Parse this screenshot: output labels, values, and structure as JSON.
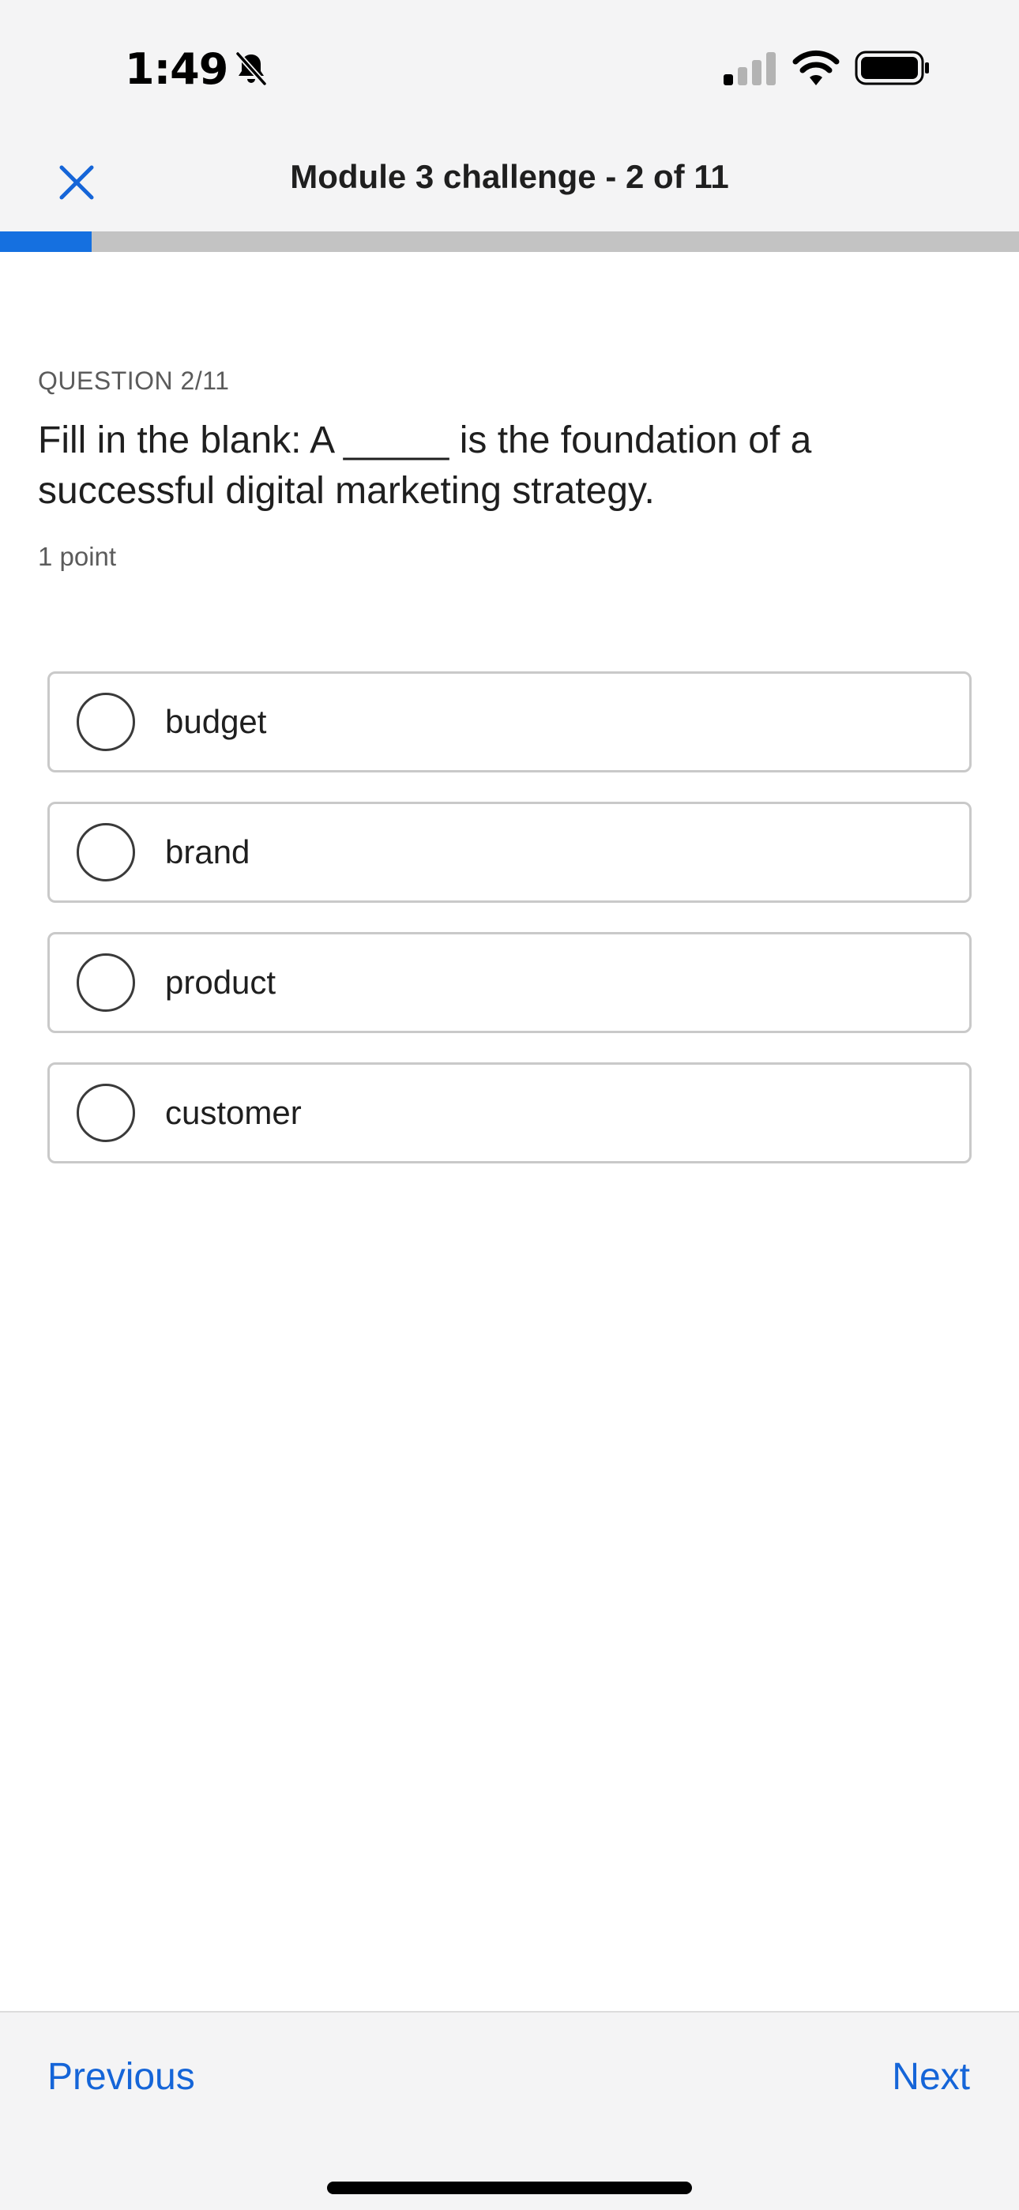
{
  "status_bar": {
    "time": "1:49",
    "icons": [
      "bell-slash-icon",
      "cellular-signal-icon",
      "wifi-icon",
      "battery-icon"
    ]
  },
  "header": {
    "title": "Module 3 challenge - 2 of 11",
    "close_icon": "close-icon"
  },
  "progress": {
    "fraction": 0.09,
    "color": "#1570e0",
    "track_color": "#c3c3c3"
  },
  "question": {
    "eyebrow": "QUESTION 2/11",
    "text": "Fill in the blank: A _____ is the foundation of a successful digital marketing strategy.",
    "points": "1 point"
  },
  "options": [
    {
      "label": "budget"
    },
    {
      "label": "brand"
    },
    {
      "label": "product"
    },
    {
      "label": "customer"
    }
  ],
  "footer": {
    "previous_label": "Previous",
    "next_label": "Next",
    "link_color": "#1565d8"
  }
}
